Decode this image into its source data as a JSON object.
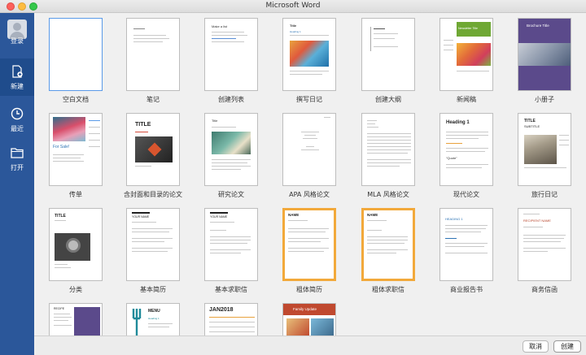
{
  "window": {
    "title": "Microsoft Word"
  },
  "sidebar": {
    "items": [
      {
        "label": "登录",
        "icon": "user-avatar-icon"
      },
      {
        "label": "新建",
        "icon": "new-document-icon"
      },
      {
        "label": "最近",
        "icon": "clock-icon"
      },
      {
        "label": "打开",
        "icon": "folder-icon"
      }
    ],
    "active_index": 1
  },
  "templates": [
    {
      "label": "空白文档",
      "thumb_text": [],
      "selected": true
    },
    {
      "label": "笔记",
      "thumb_text": []
    },
    {
      "label": "创建列表",
      "thumb_text": [
        "Make a list"
      ]
    },
    {
      "label": "撰写日记",
      "thumb_text": [
        "Title",
        "Heading 1"
      ]
    },
    {
      "label": "创建大纲",
      "thumb_text": []
    },
    {
      "label": "新闻稿",
      "thumb_text": [
        "Newsletter Title"
      ]
    },
    {
      "label": "小册子",
      "thumb_text": [
        "Brochure Title"
      ]
    },
    {
      "label": "传单",
      "thumb_text": [
        "For Sale!"
      ]
    },
    {
      "label": "含封面和目录的论文",
      "thumb_text": [
        "TITLE"
      ]
    },
    {
      "label": "研究论文",
      "thumb_text": [
        "Title"
      ]
    },
    {
      "label": "APA 风格论文",
      "thumb_text": []
    },
    {
      "label": "MLA 风格论文",
      "thumb_text": []
    },
    {
      "label": "现代论文",
      "thumb_text": [
        "Heading 1",
        "\"Quote\""
      ]
    },
    {
      "label": "旅行日记",
      "thumb_text": [
        "TITLE",
        "SUBTITLE"
      ]
    },
    {
      "label": "分类",
      "thumb_text": [
        "TITLE"
      ]
    },
    {
      "label": "基本简历",
      "thumb_text": [
        "YOUR NAME"
      ]
    },
    {
      "label": "基本求职信",
      "thumb_text": [
        "YOUR NAME"
      ]
    },
    {
      "label": "粗体简历",
      "thumb_text": [
        "NAME"
      ]
    },
    {
      "label": "粗体求职信",
      "thumb_text": [
        "NAME"
      ]
    },
    {
      "label": "商业报告书",
      "thumb_text": [
        "HEADING 1"
      ]
    },
    {
      "label": "商务信函",
      "thumb_text": [
        "RECIPIENT NAME"
      ]
    },
    {
      "label": "",
      "thumb_text": [
        "RECIPE"
      ]
    },
    {
      "label": "",
      "thumb_text": [
        "MENU",
        "Heading 1"
      ]
    },
    {
      "label": "",
      "thumb_text": [
        "JAN2018"
      ]
    },
    {
      "label": "",
      "thumb_text": [
        "Family Update"
      ]
    }
  ],
  "footer": {
    "cancel_label": "取消",
    "create_label": "创建"
  },
  "colors": {
    "sidebar": "#2b579a",
    "sidebar_active": "#1f4c8c",
    "selection": "#5a9ae8",
    "newsletter_green": "#6fa834",
    "brochure_purple": "#5b4a8b"
  }
}
